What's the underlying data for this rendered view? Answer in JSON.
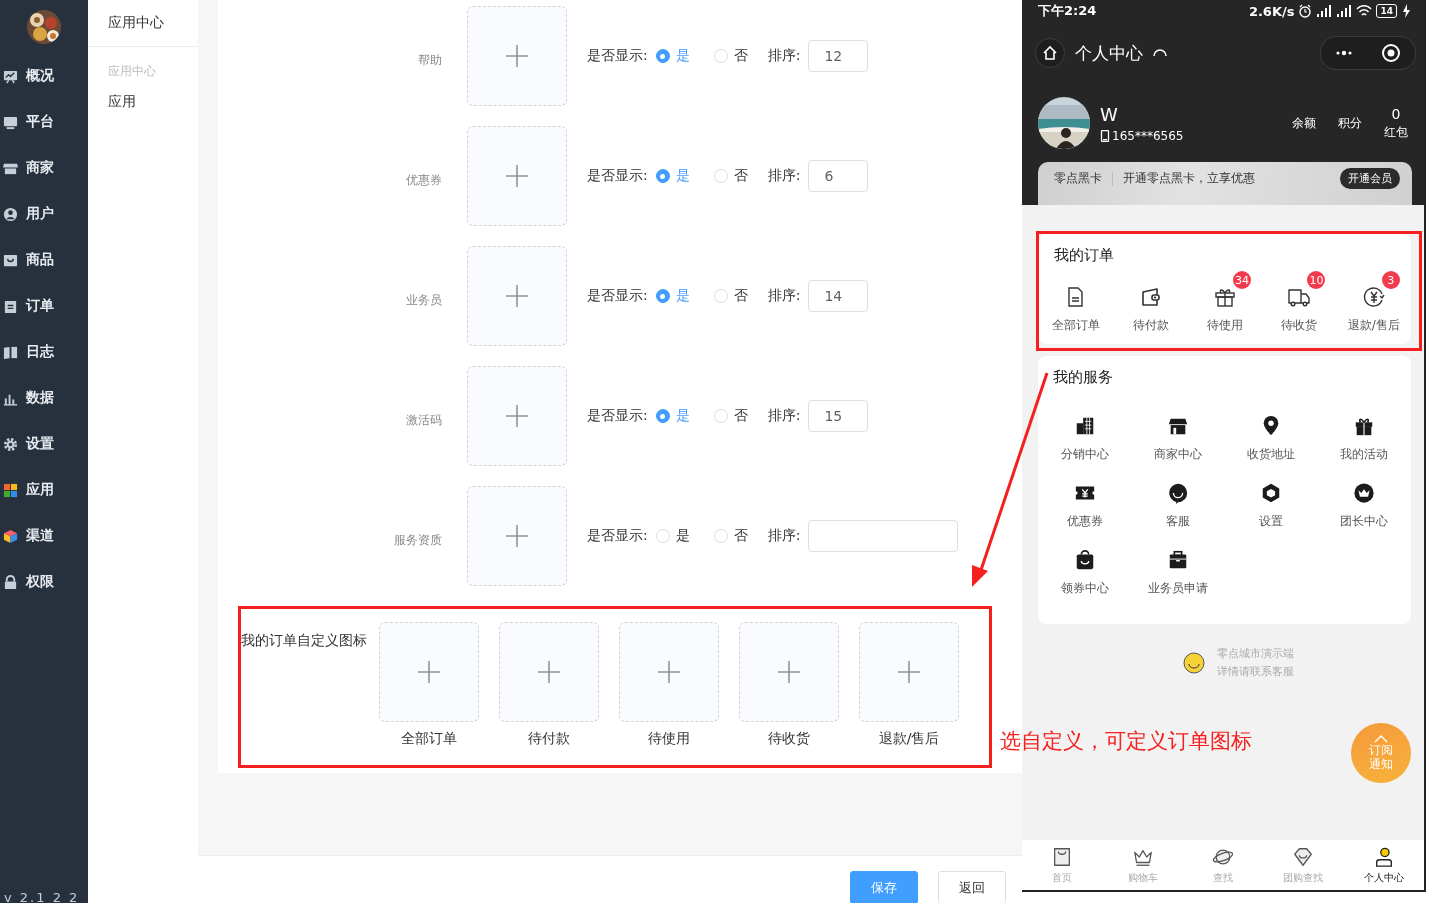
{
  "sidebar": {
    "items": [
      {
        "label": "概况"
      },
      {
        "label": "平台"
      },
      {
        "label": "商家"
      },
      {
        "label": "用户"
      },
      {
        "label": "商品"
      },
      {
        "label": "订单"
      },
      {
        "label": "日志"
      },
      {
        "label": "数据"
      },
      {
        "label": "设置"
      },
      {
        "label": "应用"
      },
      {
        "label": "渠道"
      },
      {
        "label": "权限"
      }
    ],
    "version": "v 2.1 2 2"
  },
  "submenu": {
    "title": "应用中心",
    "group": "应用中心",
    "items": [
      {
        "label": "应用"
      }
    ]
  },
  "icon_settings": [
    {
      "label": "帮助",
      "display_label": "是否显示:",
      "options": [
        {
          "label": "是",
          "selected": true
        },
        {
          "label": "否",
          "selected": false
        }
      ],
      "sort_label": "排序:",
      "sort": "12"
    },
    {
      "label": "优惠券",
      "display_label": "是否显示:",
      "options": [
        {
          "label": "是",
          "selected": true
        },
        {
          "label": "否",
          "selected": false
        }
      ],
      "sort_label": "排序:",
      "sort": "6"
    },
    {
      "label": "业务员",
      "display_label": "是否显示:",
      "options": [
        {
          "label": "是",
          "selected": true
        },
        {
          "label": "否",
          "selected": false
        }
      ],
      "sort_label": "排序:",
      "sort": "14"
    },
    {
      "label": "激活码",
      "display_label": "是否显示:",
      "options": [
        {
          "label": "是",
          "selected": true
        },
        {
          "label": "否",
          "selected": false
        }
      ],
      "sort_label": "排序:",
      "sort": "15"
    },
    {
      "label": "服务资质",
      "display_label": "是否显示:",
      "options": [
        {
          "label": "是",
          "selected": false
        },
        {
          "label": "否",
          "selected": false
        }
      ],
      "sort_label": "排序:"
    }
  ],
  "order_icons": {
    "title": "我的订单自定义图标",
    "items": [
      {
        "label": "全部订单"
      },
      {
        "label": "待付款"
      },
      {
        "label": "待使用"
      },
      {
        "label": "待收货"
      },
      {
        "label": "退款/售后"
      }
    ]
  },
  "buttons": [
    {
      "label": "保存",
      "kind": "primary"
    },
    {
      "label": "返回",
      "kind": "default"
    }
  ],
  "annotation": {
    "caption": "选自定义，可定义订单图标"
  },
  "phone": {
    "status_bar": {
      "time": "下午2:24",
      "speed": "2.6K/s",
      "battery": "14"
    },
    "nav": {
      "title": "个人中心"
    },
    "profile": {
      "name": "W",
      "phone": "165***6565",
      "stats": [
        {
          "label": "余额"
        },
        {
          "label": "积分"
        },
        {
          "value": "0",
          "label": "红包"
        }
      ]
    },
    "member_banner": {
      "title": "零点黑卡",
      "text": "开通零点黑卡，立享优惠",
      "button": "开通会员"
    },
    "orders": {
      "title": "我的订单",
      "items": [
        {
          "label": "全部订单"
        },
        {
          "label": "待付款"
        },
        {
          "label": "待使用",
          "badge": "34"
        },
        {
          "label": "待收货",
          "badge": "10"
        },
        {
          "label": "退款/售后",
          "badge": "3"
        }
      ]
    },
    "services": {
      "title": "我的服务",
      "items": [
        {
          "label": "分销中心"
        },
        {
          "label": "商家中心"
        },
        {
          "label": "收货地址"
        },
        {
          "label": "我的活动"
        },
        {
          "label": "优惠券"
        },
        {
          "label": "客服"
        },
        {
          "label": "设置"
        },
        {
          "label": "团长中心"
        },
        {
          "label": "领券中心"
        },
        {
          "label": "业务员申请"
        }
      ]
    },
    "footer": {
      "line1": "零点城市演示端",
      "line2": "详情请联系客服"
    },
    "float_button": {
      "label": "订阅通知"
    },
    "tabbar": [
      {
        "label": "首页",
        "selected": false
      },
      {
        "label": "购物车",
        "selected": false
      },
      {
        "label": "查找",
        "selected": false
      },
      {
        "label": "团购查找",
        "selected": false
      },
      {
        "label": "个人中心",
        "selected": true
      }
    ]
  }
}
